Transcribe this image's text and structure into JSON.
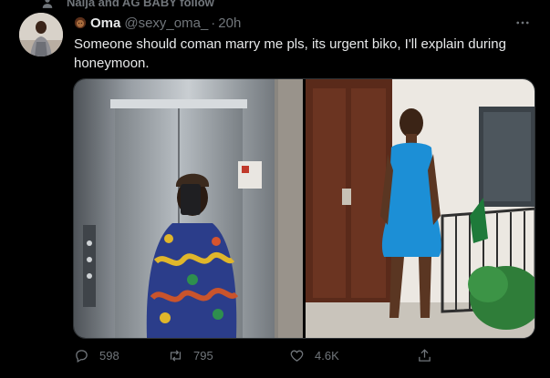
{
  "social_context": {
    "text": "Naija and AG BABY follow"
  },
  "tweet": {
    "display_name": "Oma",
    "handle": "@sexy_oma_",
    "separator": "·",
    "time": "20h",
    "text": "Someone should coman marry me pls, its urgent biko, I'll explain during honeymoon."
  },
  "actions": {
    "reply_count": "598",
    "retweet_count": "795",
    "like_count": "4.6K"
  },
  "icons": {
    "social": "person-icon",
    "emoji": "woman-emoji-icon",
    "more": "more-icon",
    "reply": "reply-icon",
    "retweet": "retweet-icon",
    "like": "heart-icon",
    "share": "share-icon"
  },
  "colors": {
    "background": "#000000",
    "primary_text": "#e7e9ea",
    "secondary_text": "#71767b",
    "border": "#2f3336"
  }
}
